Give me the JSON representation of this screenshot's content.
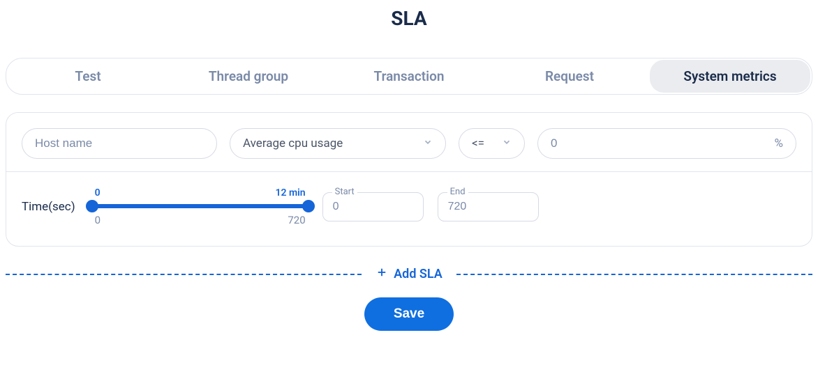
{
  "title": "SLA",
  "tabs": [
    {
      "label": "Test"
    },
    {
      "label": "Thread group"
    },
    {
      "label": "Transaction"
    },
    {
      "label": "Request"
    },
    {
      "label": "System metrics",
      "active": true
    }
  ],
  "rule": {
    "host_placeholder": "Host name",
    "metric_selected": "Average cpu usage",
    "operator_selected": "<=",
    "value": "0",
    "unit": "%"
  },
  "time": {
    "label": "Time(sec)",
    "top_left": "0",
    "top_right": "12 min",
    "bottom_left": "0",
    "bottom_right": "720",
    "start_label": "Start",
    "start_value": "0",
    "end_label": "End",
    "end_value": "720"
  },
  "actions": {
    "add_sla": "Add SLA",
    "save": "Save"
  }
}
